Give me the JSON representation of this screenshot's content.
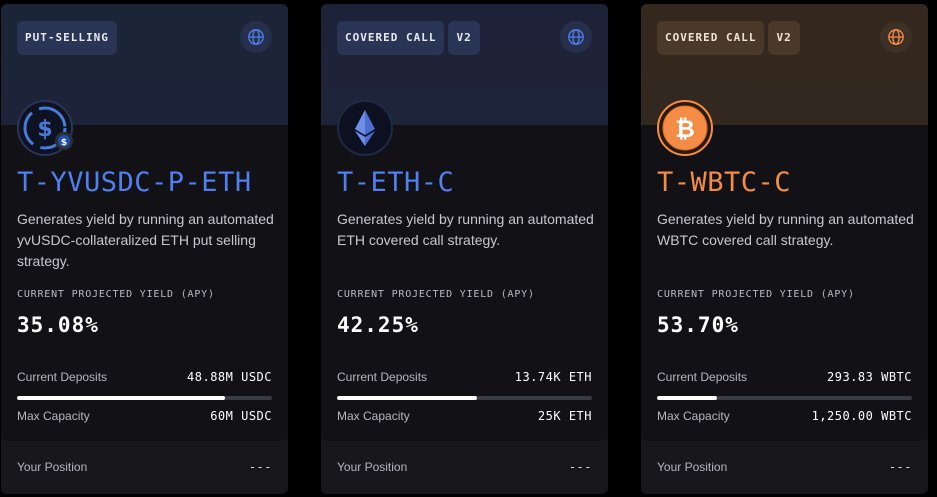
{
  "cards": [
    {
      "tags": [
        "PUT-SELLING"
      ],
      "title": "T-YVUSDC-P-ETH",
      "description": "Generates yield by running an automated yvUSDC-collateralized ETH put selling strategy.",
      "yield_label": "CURRENT PROJECTED YIELD (APY)",
      "yield_value": "35.08%",
      "deposits_label": "Current Deposits",
      "deposits_value": "48.88M USDC",
      "deposits_fill": 0.815,
      "capacity_label": "Max Capacity",
      "capacity_value": "60M USDC",
      "position_label": "Your Position",
      "position_value": "---",
      "accent": "#4f7ff0",
      "icon": "usdc-coin-icon"
    },
    {
      "tags": [
        "COVERED CALL",
        "V2"
      ],
      "title": "T-ETH-C",
      "description": "Generates yield by running an automated ETH covered call strategy.",
      "yield_label": "CURRENT PROJECTED YIELD (APY)",
      "yield_value": "42.25%",
      "deposits_label": "Current Deposits",
      "deposits_value": "13.74K ETH",
      "deposits_fill": 0.55,
      "capacity_label": "Max Capacity",
      "capacity_value": "25K ETH",
      "position_label": "Your Position",
      "position_value": "---",
      "accent": "#4f7ff0",
      "icon": "ethereum-icon"
    },
    {
      "tags": [
        "COVERED CALL",
        "V2"
      ],
      "title": "T-WBTC-C",
      "description": "Generates yield by running an automated WBTC covered call strategy.",
      "yield_label": "CURRENT PROJECTED YIELD (APY)",
      "yield_value": "53.70%",
      "deposits_label": "Current Deposits",
      "deposits_value": "293.83 WBTC",
      "deposits_fill": 0.235,
      "capacity_label": "Max Capacity",
      "capacity_value": "1,250.00 WBTC",
      "position_label": "Your Position",
      "position_value": "---",
      "accent": "#f48c45",
      "icon": "bitcoin-icon"
    }
  ]
}
